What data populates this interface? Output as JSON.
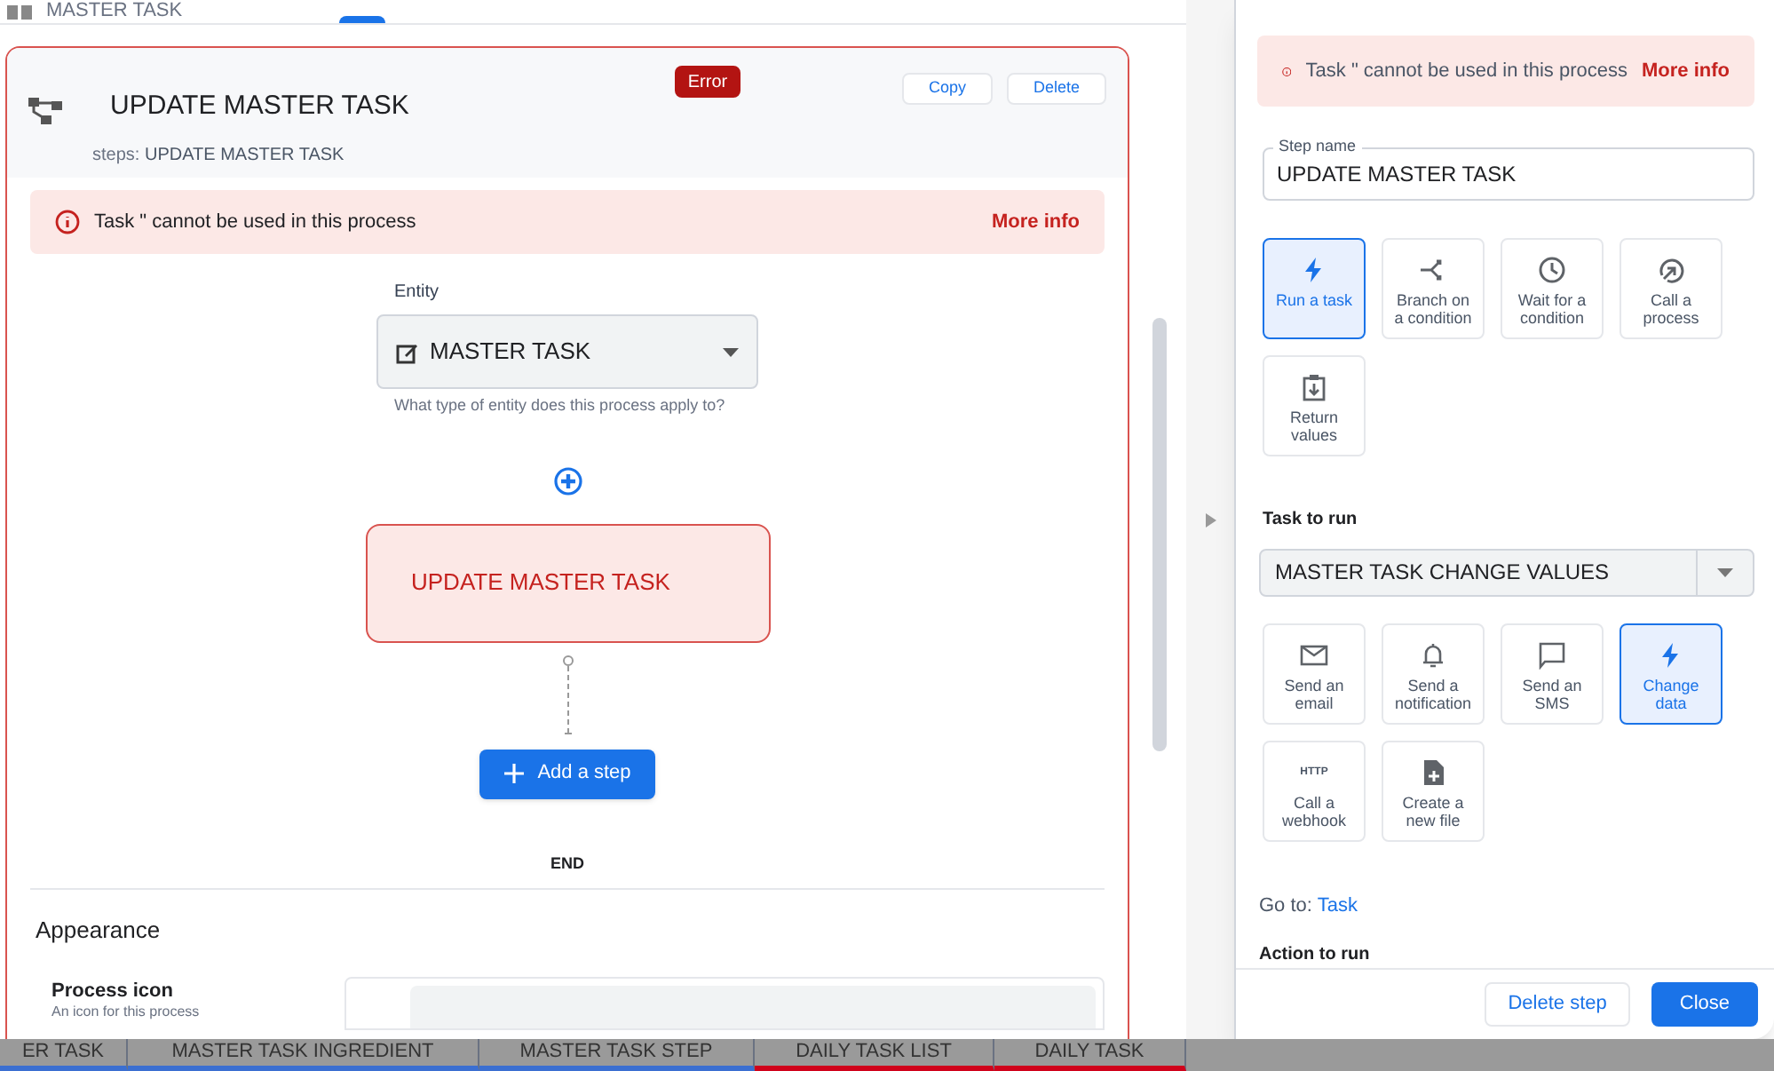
{
  "header": {
    "title": "MASTER TASK"
  },
  "step_card": {
    "title": "UPDATE MASTER TASK",
    "subtitle_label": "steps:",
    "subtitle": "UPDATE MASTER TASK",
    "badge": "Error",
    "buttons": [
      "Copy",
      "Delete"
    ]
  },
  "error_banner": {
    "message": "Task \" cannot be used in this process",
    "link": "More info"
  },
  "entity": {
    "label": "Entity",
    "value": "MASTER TASK",
    "helper": "What type of entity does this process apply to?"
  },
  "flow": {
    "step": "UPDATE MASTER TASK",
    "add_button": "Add a step",
    "end": "END"
  },
  "appearance": {
    "title": "Appearance",
    "field_label": "Process icon",
    "field_help": "An icon for this process"
  },
  "sheet_tabs": [
    {
      "label": "ER TASK",
      "color": "#3b6fd1"
    },
    {
      "label": "MASTER TASK INGREDIENT",
      "color": "#3b6fd1"
    },
    {
      "label": "MASTER TASK STEP",
      "color": "#3b6fd1"
    },
    {
      "label": "DAILY TASK LIST",
      "color": "#d0021b"
    },
    {
      "label": "DAILY TASK",
      "color": "#d0021b"
    }
  ],
  "side_panel": {
    "error": {
      "message": "Task \" cannot be used in this process",
      "link": "More info"
    },
    "step_name": {
      "label": "Step name",
      "value": "UPDATE MASTER TASK"
    },
    "step_types": [
      {
        "kind": "bolt",
        "label": "Run a task",
        "selected": true
      },
      {
        "kind": "branch",
        "label": "Branch on a condition",
        "selected": false
      },
      {
        "kind": "clock",
        "label": "Wait for a condition",
        "selected": false
      },
      {
        "kind": "call",
        "label": "Call a process",
        "selected": false
      },
      {
        "kind": "return",
        "label": "Return values",
        "selected": false
      }
    ],
    "task_to_run": {
      "label": "Task to run",
      "value": "MASTER TASK CHANGE VALUES"
    },
    "task_types": [
      {
        "kind": "email",
        "label": "Send an email",
        "selected": false
      },
      {
        "kind": "bell",
        "label": "Send a notification",
        "selected": false
      },
      {
        "kind": "chat",
        "label": "Send an SMS",
        "selected": false
      },
      {
        "kind": "bolt",
        "label": "Change data",
        "selected": true
      },
      {
        "kind": "http",
        "icon_text": "HTTP",
        "label": "Call a webhook",
        "selected": false
      },
      {
        "kind": "file",
        "label": "Create a new file",
        "selected": false
      }
    ],
    "goto": {
      "label": "Go to:",
      "link": "Task"
    },
    "action_label": "Action to run",
    "buttons": [
      "Delete step",
      "Close"
    ]
  }
}
